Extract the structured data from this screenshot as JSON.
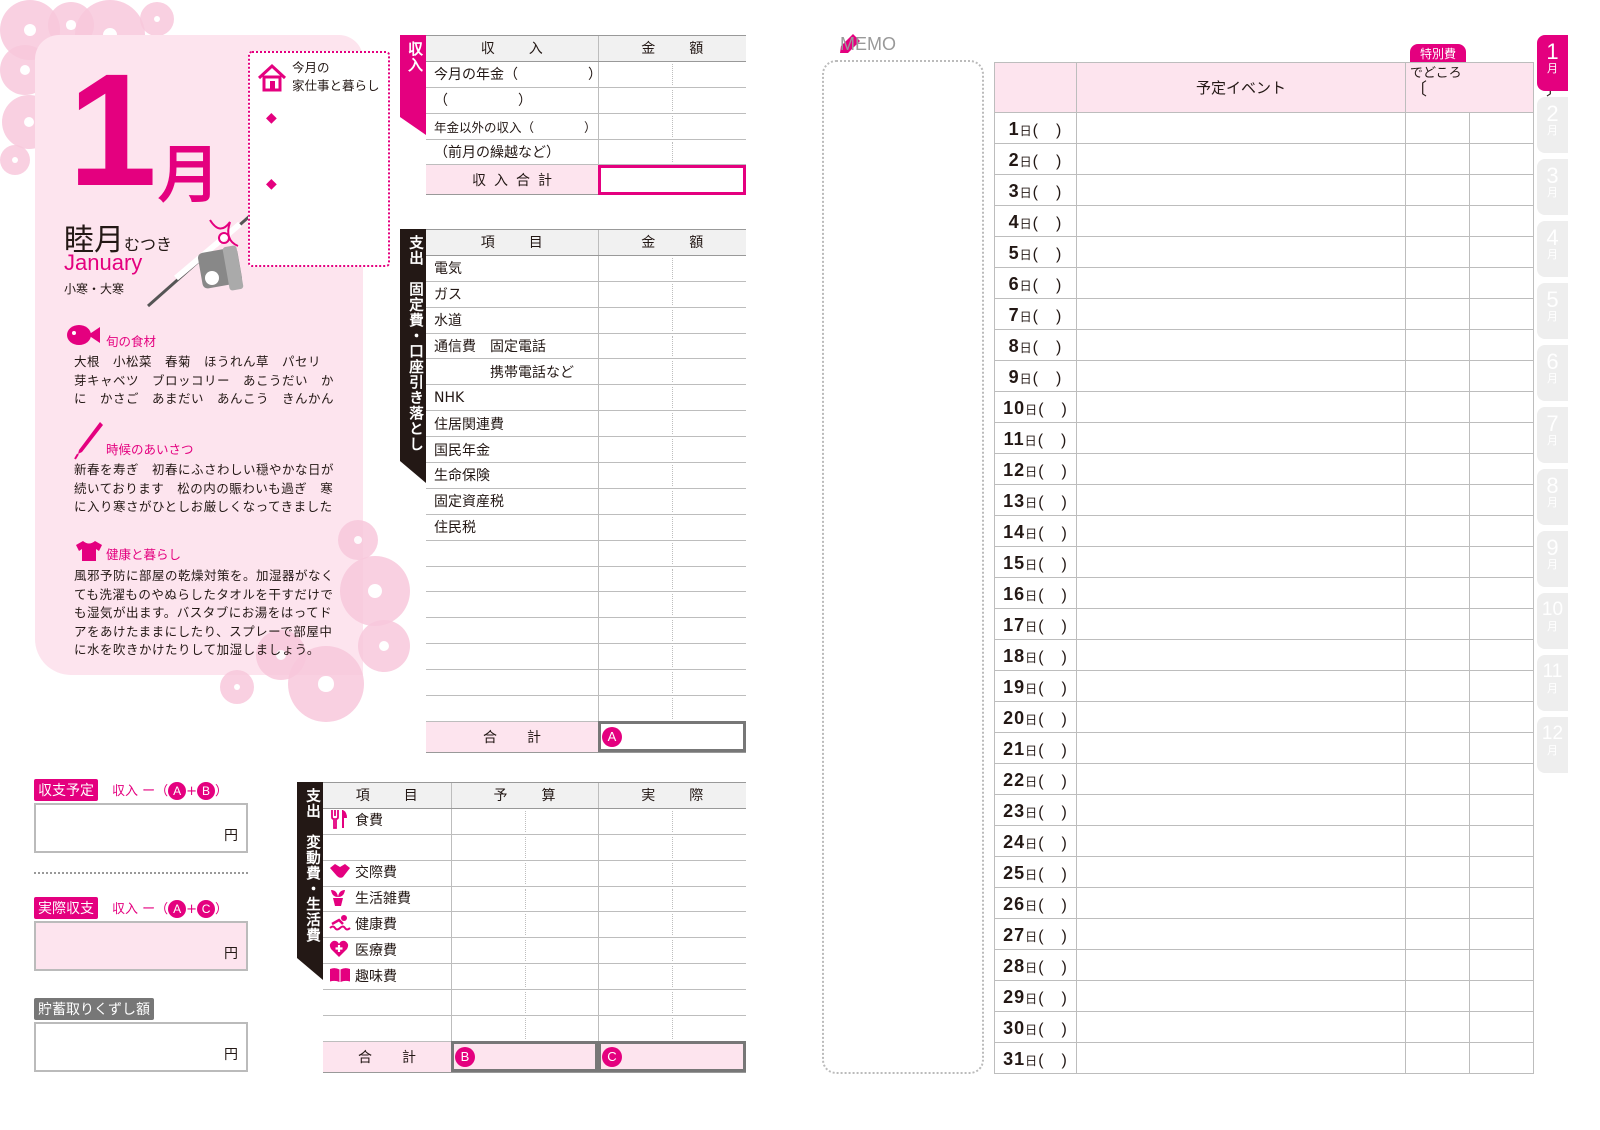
{
  "month": {
    "number": "1",
    "kanji": "月",
    "old_name": "睦月",
    "old_name_reading": "むつき",
    "english": "January",
    "seasonal_terms": "小寒・大寒"
  },
  "housework": {
    "title_line1": "今月の",
    "title_line2": "家仕事と暮らし",
    "bullets": [
      "◆",
      "◆"
    ]
  },
  "seasonal_food": {
    "title": "旬の食材",
    "text": "大根　小松菜　春菊　ほうれん草　パセリ　芽キャベツ　ブロッコリー　あこうだい　かに　かさご　あまだい　あんこう　きんかん"
  },
  "greeting": {
    "title": "時候のあいさつ",
    "text": "新春を寿ぎ　初春にふさわしい穏やかな日が続いております　松の内の賑わいも過ぎ　寒に入り寒さがひとしお厳しくなってきました"
  },
  "health": {
    "title": "健康と暮らし",
    "text": "風邪予防に部屋の乾燥対策を。加湿器がなくても洗濯ものやぬらしたタオルを干すだけでも湿気が出ます。バスタブにお湯をはってドアをあけたままにしたり、スプレーで部屋中に水を吹きかけたりして加湿しましょう。"
  },
  "income": {
    "side_label": "収入",
    "header_item": "収　入",
    "header_amount": "金　額",
    "rows": [
      "今月の年金（　　　　　）",
      "（　　　　　）",
      "年金以外の収入（　　　　）",
      "（前月の繰越など）"
    ],
    "total_label": "収入合計"
  },
  "fixed_expenses": {
    "side_label": "支出　固定費・口座引き落とし",
    "header_item": "項　目",
    "header_amount": "金　額",
    "rows": [
      "電気",
      "ガス",
      "水道",
      "通信費　固定電話",
      "　　　　携帯電話など",
      "NHK",
      "住居関連費",
      "国民年金",
      "生命保険",
      "固定資産税",
      "住民税",
      "",
      "",
      "",
      "",
      "",
      "",
      ""
    ],
    "total_label": "合　計",
    "total_mark": "A"
  },
  "variable_expenses": {
    "side_label": "支出　変動費・生活費",
    "header_item": "項　目",
    "header_budget": "予　算",
    "header_actual": "実　際",
    "rows": [
      {
        "icon": "fork-knife-icon",
        "label": "食費"
      },
      {
        "icon": "",
        "label": ""
      },
      {
        "icon": "handshake-icon",
        "label": "交際費"
      },
      {
        "icon": "plant-icon",
        "label": "生活雑費"
      },
      {
        "icon": "swimmer-icon",
        "label": "健康費"
      },
      {
        "icon": "medical-heart-icon",
        "label": "医療費"
      },
      {
        "icon": "book-icon",
        "label": "趣味費"
      },
      {
        "icon": "",
        "label": ""
      },
      {
        "icon": "",
        "label": ""
      }
    ],
    "total_label": "合　計",
    "total_budget_mark": "B",
    "total_actual_mark": "C"
  },
  "balance": {
    "planned": {
      "tag": "収支予定",
      "formula_prefix": "収入 ー（",
      "m1": "A",
      "plus": "+",
      "m2": "B",
      "formula_suffix": "）",
      "unit": "円"
    },
    "actual": {
      "tag": "実際収支",
      "formula_prefix": "収入 ー（",
      "m1": "A",
      "plus": "+",
      "m2": "C",
      "formula_suffix": "）",
      "unit": "円"
    },
    "savings": {
      "tag": "貯蓄取りくずし額",
      "unit": "円"
    }
  },
  "memo": {
    "label": "MEMO"
  },
  "calendar": {
    "header_event": "予定イベント",
    "special_tag": "特別費",
    "special_sub": "でどころ",
    "special_bracket": "〔　　　　　　　〕",
    "day_suffix": "日",
    "weekday_blank": "(　)",
    "days": [
      "1",
      "2",
      "3",
      "4",
      "5",
      "6",
      "7",
      "8",
      "9",
      "10",
      "11",
      "12",
      "13",
      "14",
      "15",
      "16",
      "17",
      "18",
      "19",
      "20",
      "21",
      "22",
      "23",
      "24",
      "25",
      "26",
      "27",
      "28",
      "29",
      "30",
      "31"
    ]
  },
  "month_tabs": {
    "suffix": "月",
    "items": [
      "1",
      "2",
      "3",
      "4",
      "5",
      "6",
      "7",
      "8",
      "9",
      "10",
      "11",
      "12"
    ],
    "active": "1"
  },
  "colors": {
    "accent": "#e4007f",
    "card_bg": "#fde4ee",
    "blossom": "#f8c8dc"
  }
}
